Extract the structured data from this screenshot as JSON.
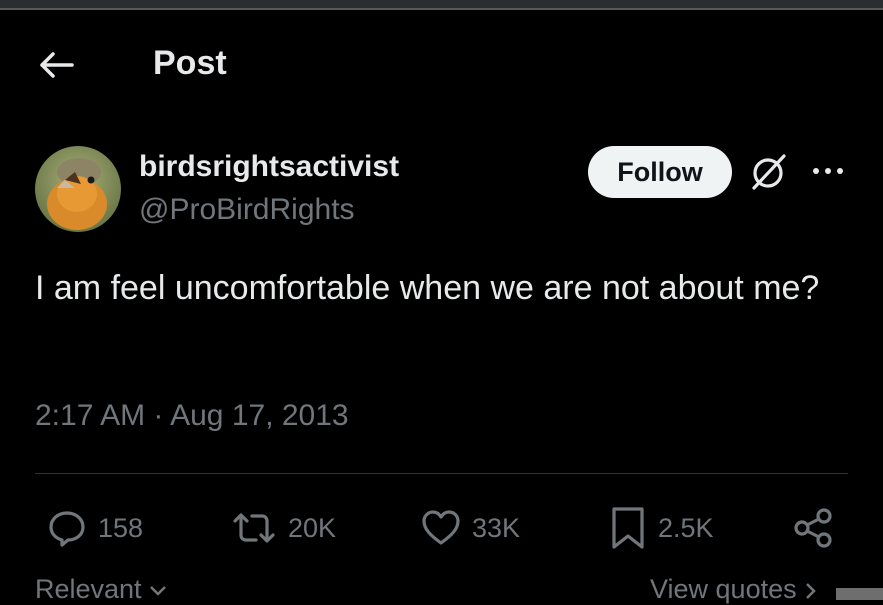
{
  "header": {
    "title": "Post"
  },
  "author": {
    "display_name": "birdsrightsactivist",
    "handle": "@ProBirdRights"
  },
  "follow_button": {
    "label": "Follow"
  },
  "tweet": {
    "text": "I am feel uncomfortable when we are not about me?",
    "time": "2:17 AM",
    "separator": "·",
    "date": "Aug 17, 2013"
  },
  "actions": {
    "replies": "158",
    "reposts": "20K",
    "likes": "33K",
    "bookmarks": "2.5K"
  },
  "footer": {
    "sort_label": "Relevant",
    "view_quotes_label": "View quotes"
  },
  "icons": {
    "back": "arrow-left-icon",
    "grok": "grok-icon",
    "more": "more-icon",
    "reply": "reply-icon",
    "repost": "repost-icon",
    "like": "heart-icon",
    "bookmark": "bookmark-icon",
    "share": "share-icon"
  },
  "colors": {
    "background": "#000000",
    "text_primary": "#e7e9ea",
    "text_secondary": "#71767b",
    "follow_bg": "#eff3f4",
    "follow_text": "#0f1419",
    "divider": "#2f3336"
  }
}
